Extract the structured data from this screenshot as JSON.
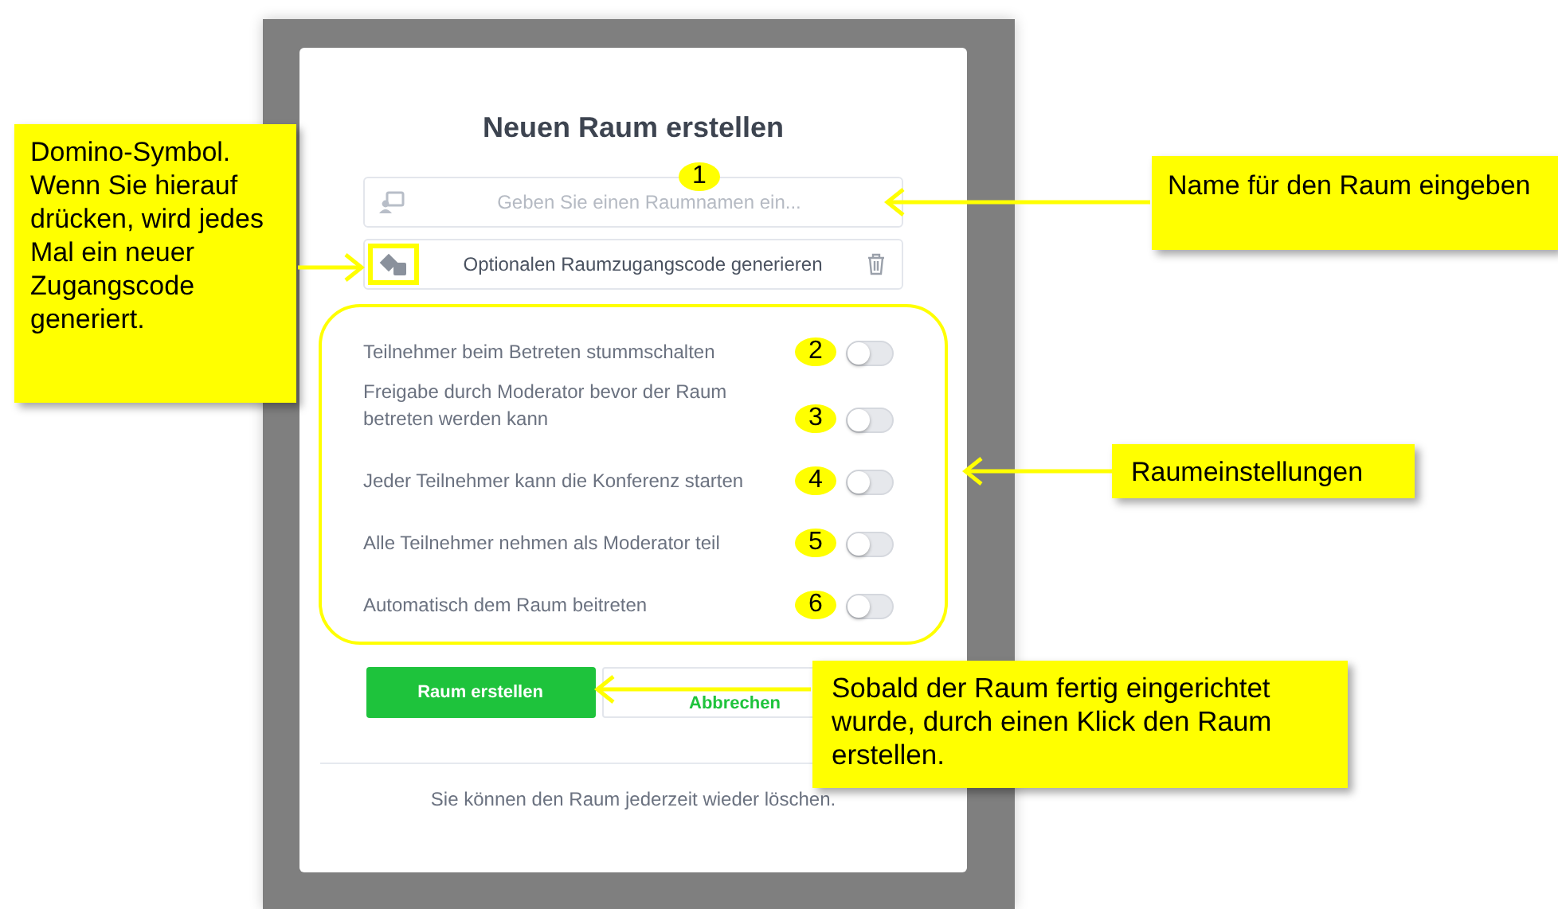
{
  "dialog": {
    "title": "Neuen Raum erstellen",
    "name_field": {
      "placeholder": "Geben Sie einen Raumnamen ein...",
      "marker": "1"
    },
    "access_code": {
      "label": "Optionalen Raumzugangscode generieren"
    },
    "settings": [
      {
        "label": "Teilnehmer beim Betreten stummschalten",
        "on": false,
        "marker": "2"
      },
      {
        "label": "Freigabe durch Moderator bevor der Raum betreten werden kann",
        "on": false,
        "marker": "3"
      },
      {
        "label": "Jeder Teilnehmer kann die Konferenz starten",
        "on": false,
        "marker": "4"
      },
      {
        "label": "Alle Teilnehmer nehmen als Moderator teil",
        "on": false,
        "marker": "5"
      },
      {
        "label": "Automatisch dem Raum beitreten",
        "on": false,
        "marker": "6"
      }
    ],
    "buttons": [
      {
        "label": "Raum erstellen",
        "kind": "primary"
      },
      {
        "label": "Abbrechen",
        "kind": "secondary"
      }
    ],
    "footer_note": "Sie können den Raum jederzeit wieder löschen."
  },
  "callouts": [
    {
      "text": "Domino-Symbol. Wenn Sie hierauf drücken, wird jedes Mal ein neuer Zugangscode generiert."
    },
    {
      "text": "Name für den Raum eingeben"
    },
    {
      "text": "Raumeinstellungen"
    },
    {
      "text": "Sobald der Raum fertig eingerichtet wurde, durch einen Klick den Raum erstellen."
    }
  ]
}
